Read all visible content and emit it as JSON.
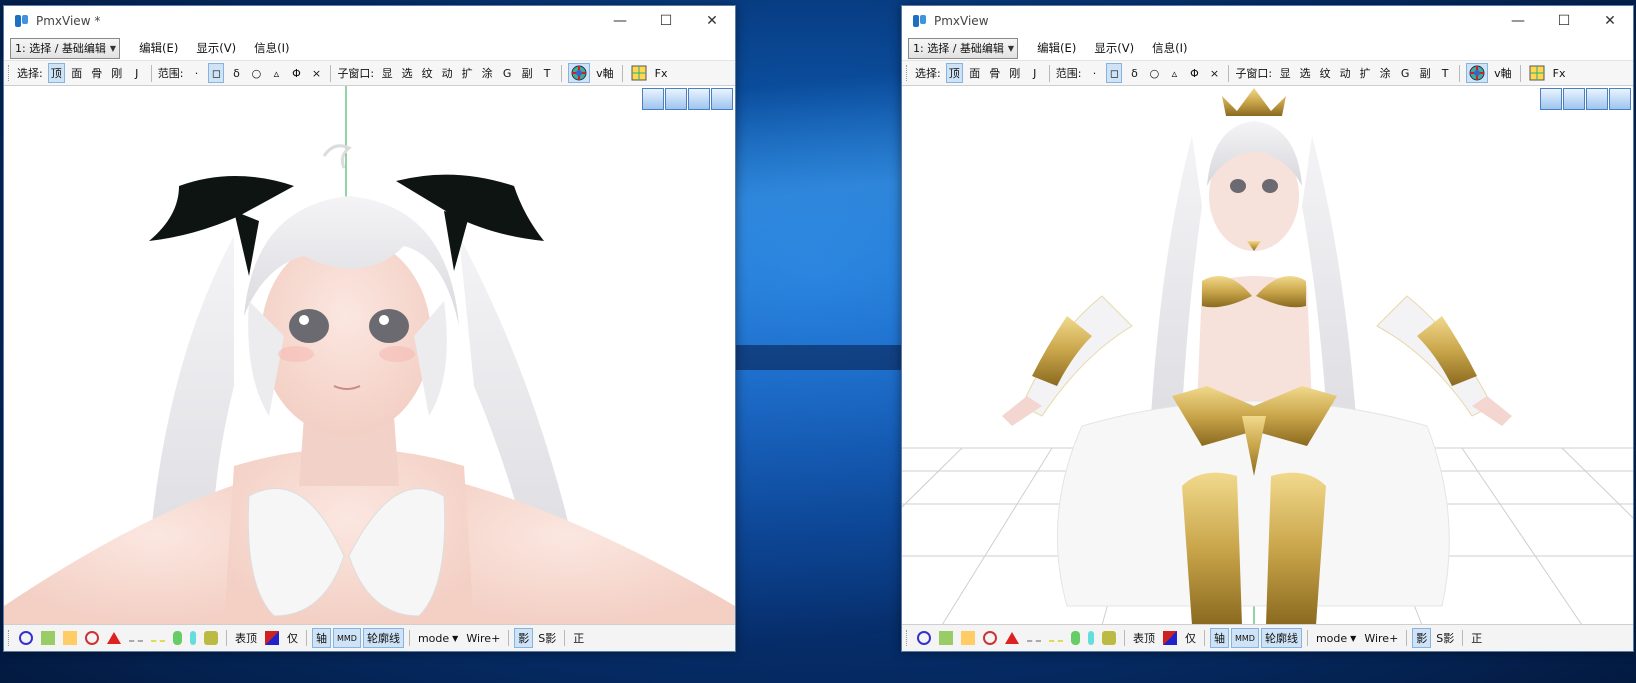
{
  "left_window": {
    "title": "PmxView *",
    "mode_select": "1: 选择 / 基础编辑",
    "menus": [
      "编辑(E)",
      "显示(V)",
      "信息(I)"
    ],
    "toolbar": {
      "select_label": "选择:",
      "select_buttons": [
        "顶",
        "面",
        "骨",
        "刚",
        "J"
      ],
      "range_label": "范围:",
      "range_buttons": [
        "·",
        "◻",
        "δ",
        "○",
        "▵",
        "Φ",
        "×"
      ],
      "subwindow_label": "子窗口:",
      "subwindow_buttons": [
        "显",
        "选",
        "纹",
        "动",
        "扩",
        "涂",
        "G",
        "副",
        "T"
      ],
      "vaxis_label": "v軸",
      "fx_label": "Fx"
    },
    "status": {
      "table_top": "表顶",
      "only": "仅",
      "axis": "轴",
      "mmd": "MMD",
      "outline": "轮廓线",
      "mode": "mode",
      "wire": "Wire+",
      "shadow": "影",
      "s_shadow": "S影",
      "front": "正"
    }
  },
  "right_window": {
    "title": "PmxView",
    "mode_select": "1: 选择 / 基础编辑",
    "menus": [
      "编辑(E)",
      "显示(V)",
      "信息(I)"
    ],
    "toolbar": {
      "select_label": "选择:",
      "select_buttons": [
        "顶",
        "面",
        "骨",
        "刚",
        "J"
      ],
      "range_label": "范围:",
      "range_buttons": [
        "·",
        "◻",
        "δ",
        "○",
        "▵",
        "Φ",
        "×"
      ],
      "subwindow_label": "子窗口:",
      "subwindow_buttons": [
        "显",
        "选",
        "纹",
        "动",
        "扩",
        "涂",
        "G",
        "副",
        "T"
      ],
      "vaxis_label": "v軸",
      "fx_label": "Fx"
    },
    "status": {
      "table_top": "表顶",
      "only": "仅",
      "axis": "轴",
      "mmd": "MMD",
      "outline": "轮廓线",
      "mode": "mode",
      "wire": "Wire+",
      "shadow": "影",
      "s_shadow": "S影",
      "front": "正"
    }
  },
  "icons": {
    "app": "pmxview-app-icon",
    "minimize": "minimize-icon",
    "maximize": "maximize-icon",
    "close": "close-icon",
    "nav": [
      "move-xy-icon",
      "move-xz-icon",
      "zoom-icon",
      "rotate-icon"
    ]
  },
  "colors": {
    "desktop": "#0b4fa0",
    "active_button": "#cfe3f7",
    "hair": "#e8e8ea",
    "ribbon": "#0e1412",
    "armor_gold": "#c9a54a"
  }
}
